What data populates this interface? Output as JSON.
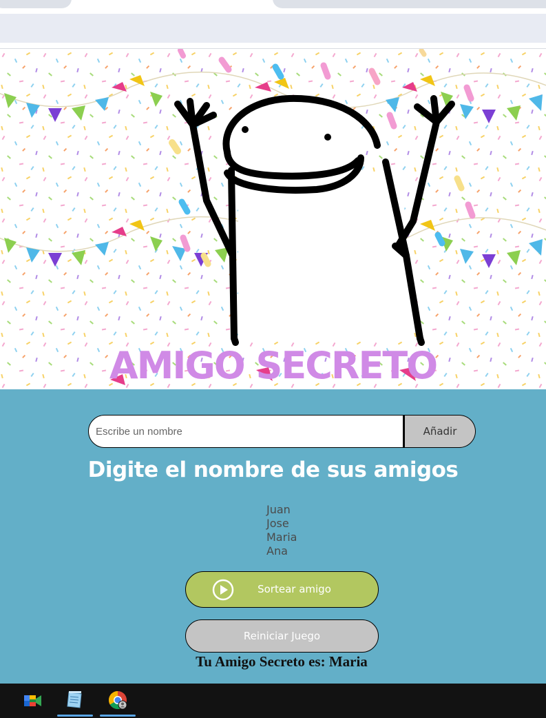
{
  "hero": {
    "title": "AMIGO SECRETO"
  },
  "form": {
    "input_placeholder": "Escribe un nombre",
    "input_value": "",
    "add_label": "Añadir"
  },
  "subtitle": "Digite el nombre de sus amigos",
  "friends": [
    "Juan",
    "Jose",
    "Maria",
    "Ana"
  ],
  "buttons": {
    "draw_label": "Sortear amigo",
    "reset_label": "Reiniciar Juego"
  },
  "result": "Tu Amigo Secreto es: Maria",
  "taskbar": {
    "items": [
      {
        "icon": "google-meet-icon",
        "active": false
      },
      {
        "icon": "notepad-icon",
        "active": true
      },
      {
        "icon": "chrome-icon",
        "active": true
      }
    ]
  },
  "colors": {
    "main_bg": "#63afc8",
    "title": "#d08ae6",
    "draw_button": "#b2c760",
    "neutral_button": "#c4c4c4"
  }
}
